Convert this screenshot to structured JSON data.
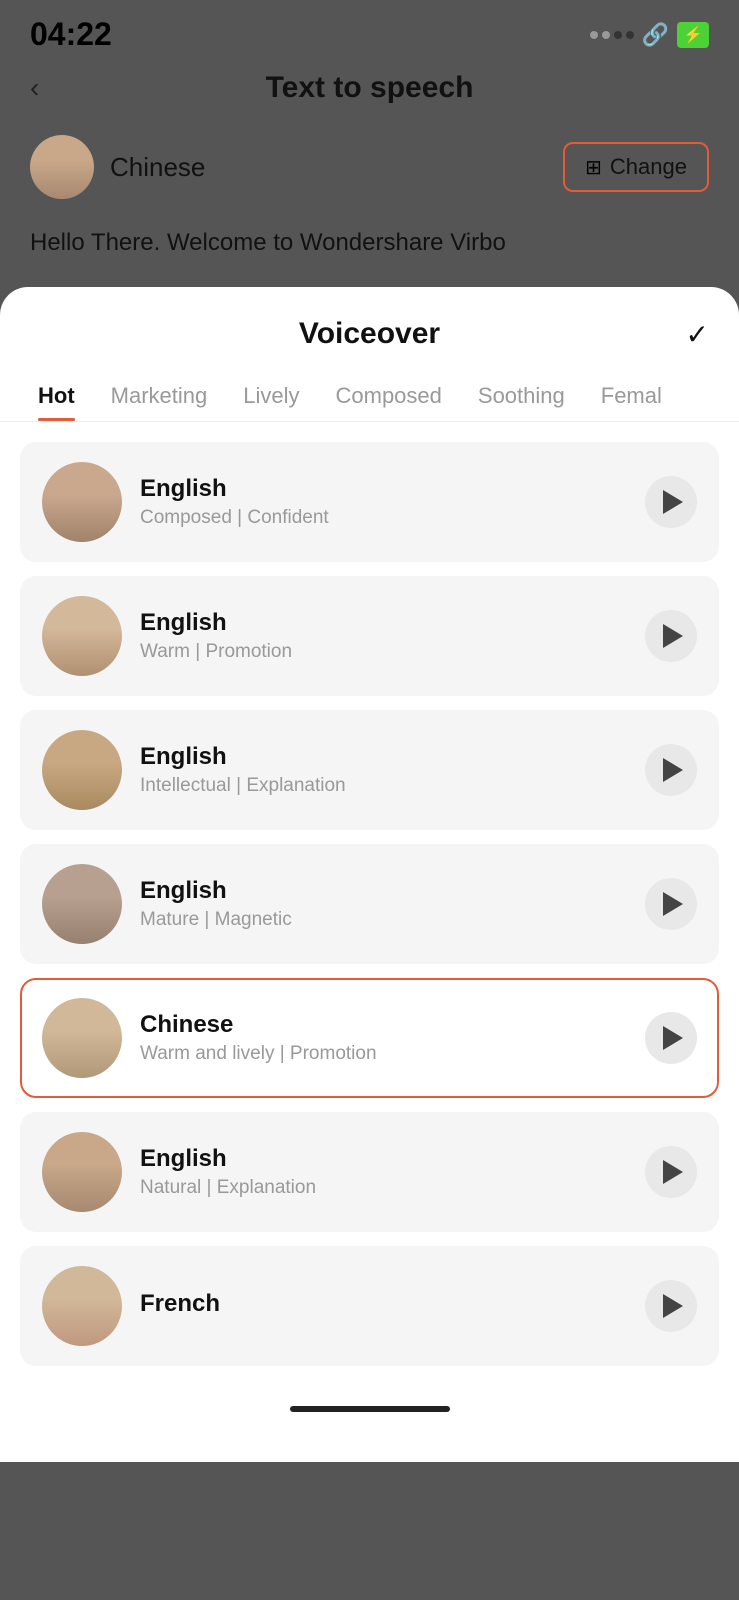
{
  "statusBar": {
    "time": "04:22",
    "batteryLabel": "⚡"
  },
  "topBar": {
    "backLabel": "‹",
    "title": "Text to speech"
  },
  "voiceSelector": {
    "voiceName": "Chinese",
    "changeLabel": "Change"
  },
  "previewText": "Hello There. Welcome to Wondershare Virbo",
  "sheet": {
    "title": "Voiceover",
    "checkLabel": "✓",
    "tabs": [
      {
        "id": "hot",
        "label": "Hot",
        "active": true
      },
      {
        "id": "marketing",
        "label": "Marketing",
        "active": false
      },
      {
        "id": "lively",
        "label": "Lively",
        "active": false
      },
      {
        "id": "composed",
        "label": "Composed",
        "active": false
      },
      {
        "id": "soothing",
        "label": "Soothing",
        "active": false
      },
      {
        "id": "female",
        "label": "Femal",
        "active": false
      }
    ],
    "voices": [
      {
        "id": 1,
        "lang": "English",
        "tags": "Composed | Confident",
        "selected": false
      },
      {
        "id": 2,
        "lang": "English",
        "tags": "Warm | Promotion",
        "selected": false
      },
      {
        "id": 3,
        "lang": "English",
        "tags": "Intellectual | Explanation",
        "selected": false
      },
      {
        "id": 4,
        "lang": "English",
        "tags": "Mature | Magnetic",
        "selected": false
      },
      {
        "id": 5,
        "lang": "Chinese",
        "tags": "Warm and lively | Promotion",
        "selected": true
      },
      {
        "id": 6,
        "lang": "English",
        "tags": "Natural | Explanation",
        "selected": false
      },
      {
        "id": 7,
        "lang": "French",
        "tags": "",
        "selected": false
      }
    ]
  }
}
